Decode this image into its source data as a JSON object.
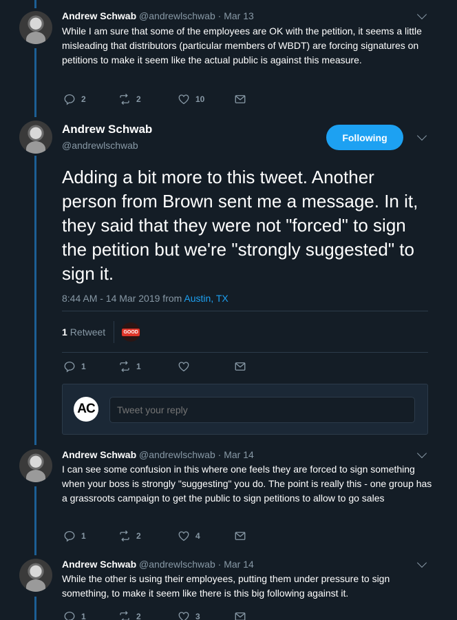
{
  "tweet1": {
    "name": "Andrew Schwab",
    "handle": "@andrewlschwab",
    "dot": "·",
    "date": "Mar 13",
    "text": "While I am sure that some of the employees are OK with the petition, it seems a little misleading that distributors (particular members of WBDT) are forcing signatures on petitions to make it seem like the actual public is against this measure.",
    "replies": "2",
    "retweets": "2",
    "likes": "10"
  },
  "focused": {
    "name": "Andrew Schwab",
    "handle": "@andrewlschwab",
    "follow_label": "Following",
    "text": "Adding a bit more to this tweet. Another person from Brown sent me a message. In it, they said that they were not \"forced\" to sign the petition but we're \"strongly suggested\" to sign it.",
    "time": "8:44 AM - 14 Mar 2019 from ",
    "location": "Austin, TX",
    "retweet_count": "1",
    "retweet_label": "Retweet",
    "retweeter_badge": "GOOD",
    "replies": "1",
    "retweets": "1"
  },
  "reply_box": {
    "avatar_text": "AC",
    "placeholder": "Tweet your reply"
  },
  "tweet3": {
    "name": "Andrew Schwab",
    "handle": "@andrewlschwab",
    "dot": "·",
    "date": "Mar 14",
    "text": "I can see some confusion in this where one feels they are forced to sign something when your boss is strongly \"suggesting\" you do. The point is really this - one group has a grassroots campaign to get the public to sign petitions to allow to go sales",
    "replies": "1",
    "retweets": "2",
    "likes": "4"
  },
  "tweet4": {
    "name": "Andrew Schwab",
    "handle": "@andrewlschwab",
    "dot": "·",
    "date": "Mar 14",
    "text": "While the other is using their employees, putting them under pressure to sign something, to make it seem like there is this big following against it.",
    "replies": "1",
    "retweets": "2",
    "likes": "3"
  },
  "colors": {
    "background": "#141d26",
    "accent": "#1da1f2",
    "muted": "#8899a6",
    "thread": "#1c5f95"
  }
}
